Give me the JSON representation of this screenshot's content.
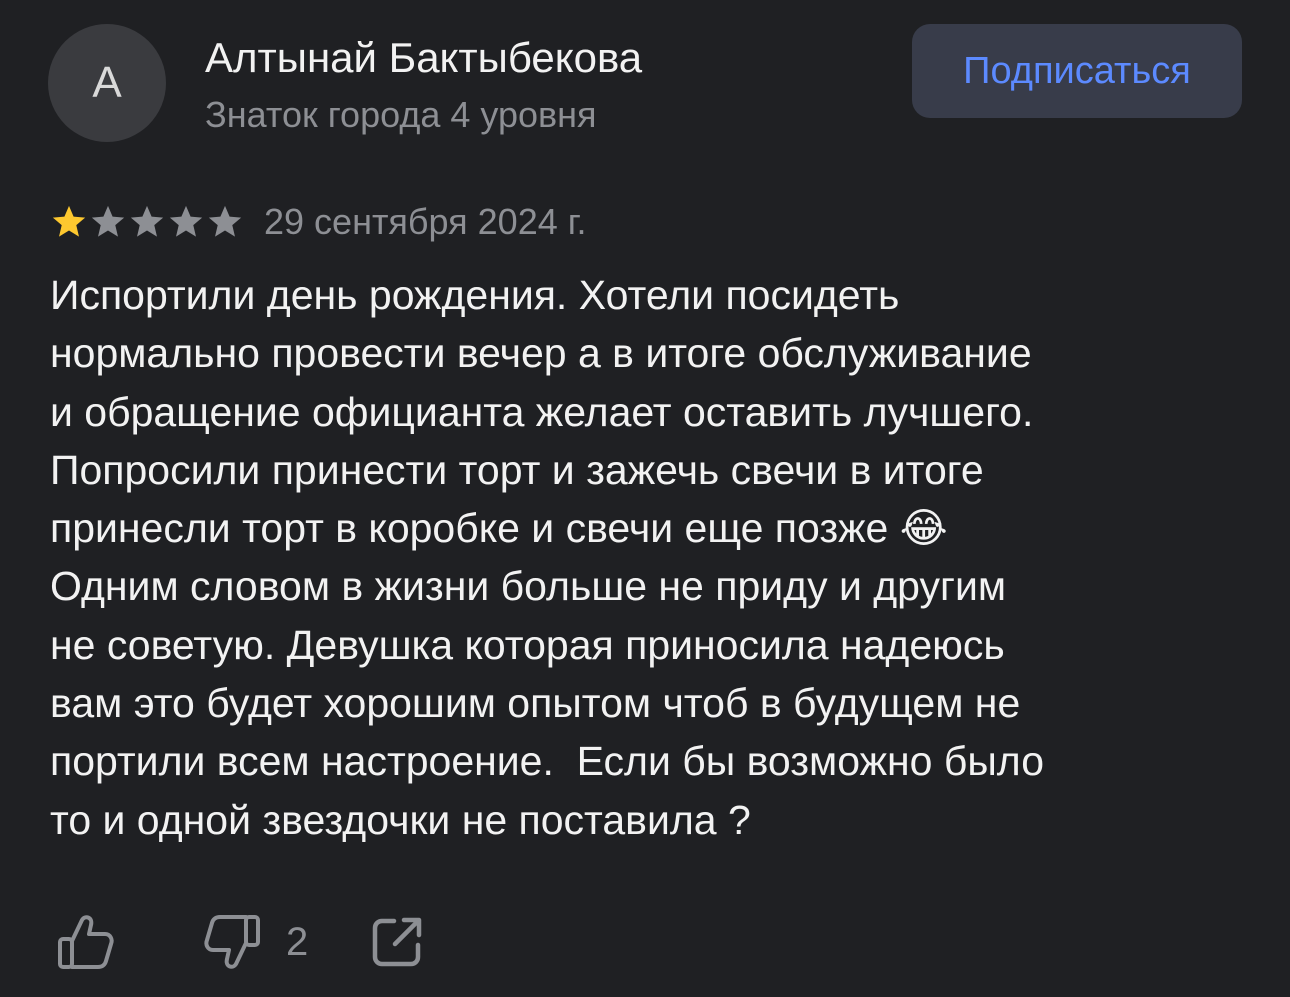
{
  "author": {
    "avatar_letter": "А",
    "name": "Алтынай Бактыбекова",
    "level": "Знаток города 4 уровня"
  },
  "subscribe": {
    "label": "Подписаться"
  },
  "review": {
    "rating": 1,
    "max_rating": 5,
    "date": "29 сентября 2024 г.",
    "text": "Испортили день рождения. Хотели посидеть\nнормально провести вечер а в итоге обслуживание\nи обращение официанта желает оставить лучшего.\nПопросили принести торт и зажечь свечи в итоге\nпринесли торт в коробке и свечи еще позже 😂\nОдним словом в жизни больше не приду и другим\nне советую. Девушка которая приносила надеюсь\nвам это будет хорошим опытом чтоб в будущем не\nпортили всем настроение.  Если бы возможно было\nто и одной звездочки не поставила ?"
  },
  "actions": {
    "like_icon": "thumbs-up-icon",
    "dislike_icon": "thumbs-down-icon",
    "dislike_count": "2",
    "share_icon": "share-icon"
  },
  "colors": {
    "background": "#1f2023",
    "star_filled": "#fdc82f",
    "star_empty": "#8d8f94",
    "accent": "#5c8aff",
    "secondary_text": "#8d8f94"
  }
}
